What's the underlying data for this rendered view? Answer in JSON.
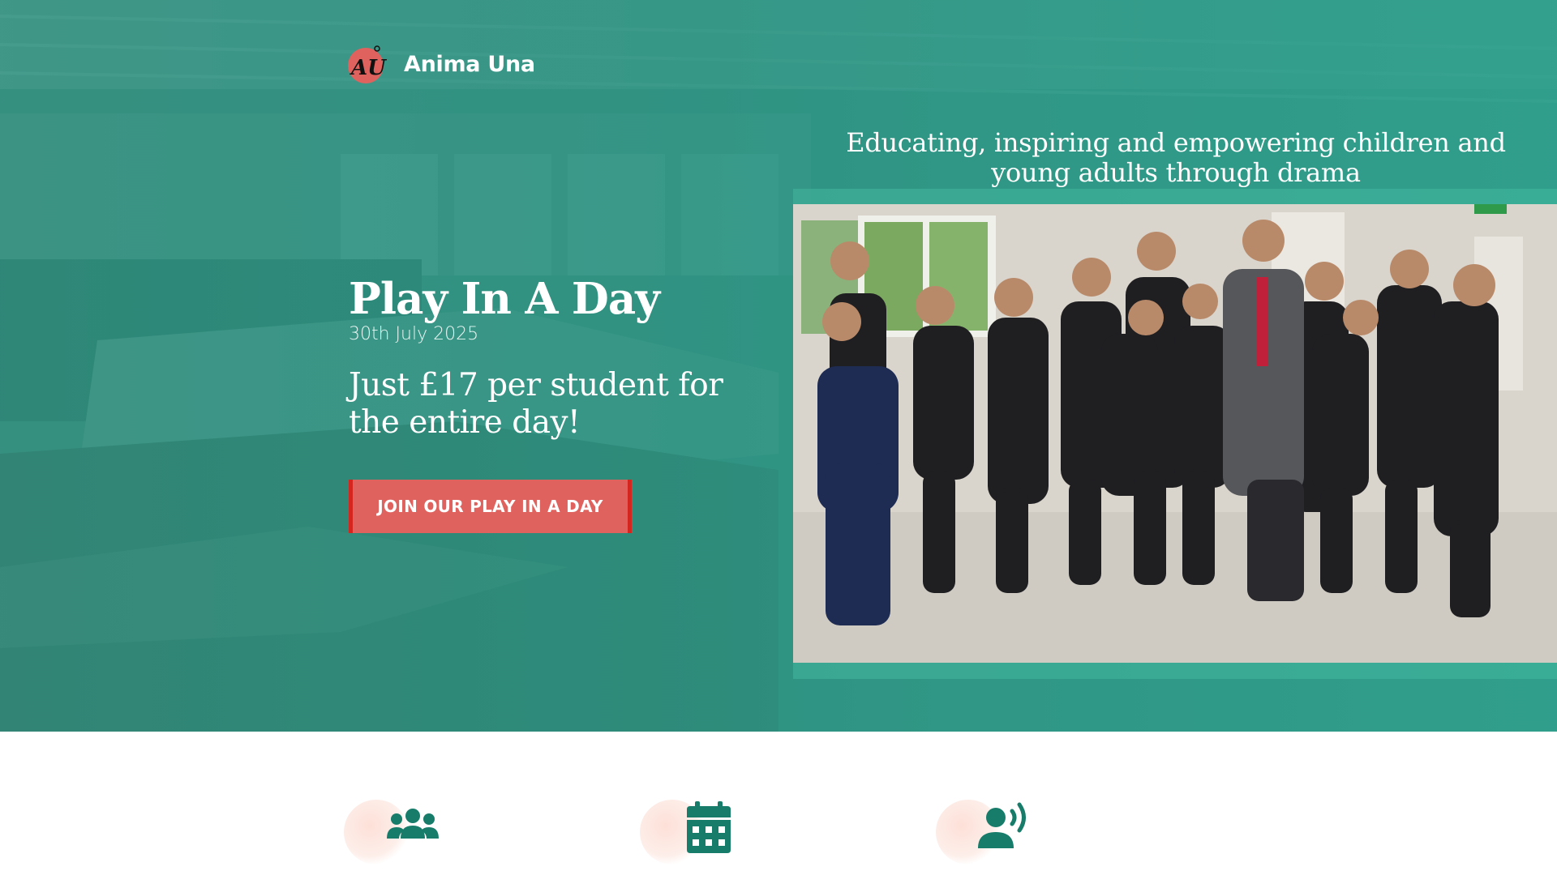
{
  "brand": {
    "name": "Anima Una",
    "logo_letters": "AU"
  },
  "hero": {
    "tagline": "Educating, inspiring and empowering children and young adults through drama",
    "event_title": "Play In A Day",
    "event_date": "30th July 2025",
    "price_text": "Just £17 per student for the entire day!",
    "cta_label": "JOIN OUR PLAY IN A DAY"
  },
  "features": [
    {
      "icon": "users-group-icon"
    },
    {
      "icon": "calendar-icon"
    },
    {
      "icon": "speaking-person-icon"
    }
  ],
  "colors": {
    "teal": "#26917f",
    "cta": "#e0625e",
    "cta_border": "#d4261f",
    "icon": "#187c6a",
    "blob": "#fde3db"
  }
}
